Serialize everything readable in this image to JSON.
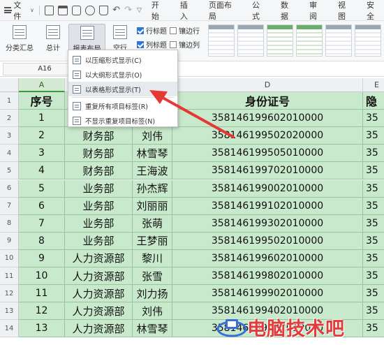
{
  "menubar": {
    "file_label": "文件",
    "tabs": [
      "开始",
      "插入",
      "页面布局",
      "公式",
      "数据",
      "审阅",
      "视图",
      "安全"
    ]
  },
  "ribbon": {
    "buttons": [
      "分类汇总",
      "总计",
      "报表布局",
      "空行"
    ],
    "checkboxes": [
      {
        "label": "行标题",
        "checked": true
      },
      {
        "label": "镶边行",
        "checked": false
      },
      {
        "label": "列标题",
        "checked": true
      },
      {
        "label": "镶边列",
        "checked": false
      }
    ]
  },
  "formula_bar": {
    "cell_ref": "A16"
  },
  "dropdown": {
    "items": [
      "以压缩形式显示(C)",
      "以大纲形式显示(O)",
      "以表格形式显示(T)",
      "重复所有项目标签(R)",
      "不显示重复项目标签(N)"
    ],
    "hovered_index": 2
  },
  "columns": [
    "A",
    "B",
    "C",
    "D",
    "E"
  ],
  "rows": [
    "1",
    "2",
    "3",
    "4",
    "5",
    "6",
    "7",
    "8",
    "9",
    "10",
    "11",
    "12",
    "13",
    "14"
  ],
  "table": {
    "header": [
      "序号",
      "部门",
      "姓名",
      "身份证号",
      "隐"
    ],
    "data": [
      [
        "1",
        "财务部",
        "张三",
        "358146199602010000",
        "35"
      ],
      [
        "2",
        "财务部",
        "刘伟",
        "358146199502020000",
        "35"
      ],
      [
        "3",
        "财务部",
        "林雪琴",
        "358146199505010000",
        "35"
      ],
      [
        "4",
        "财务部",
        "王海波",
        "358146199702010000",
        "35"
      ],
      [
        "5",
        "业务部",
        "孙杰辉",
        "358146199002010000",
        "35"
      ],
      [
        "6",
        "业务部",
        "刘丽丽",
        "358146199102010000",
        "35"
      ],
      [
        "7",
        "业务部",
        "张萌",
        "358146199302010000",
        "35"
      ],
      [
        "8",
        "业务部",
        "王梦丽",
        "358146199502010000",
        "35"
      ],
      [
        "9",
        "人力资源部",
        "黎川",
        "358146199602010000",
        "35"
      ],
      [
        "10",
        "人力资源部",
        "张雪",
        "358146199802010000",
        "35"
      ],
      [
        "11",
        "人力资源部",
        "刘力扬",
        "358146199902010000",
        "35"
      ],
      [
        "12",
        "人力资源部",
        "刘伟",
        "358146199402010000",
        "35"
      ],
      [
        "13",
        "人力资源部",
        "林雪琴",
        "358146199602010000",
        "35"
      ]
    ]
  },
  "watermark": {
    "text": "电脑技术吧"
  },
  "colors": {
    "cell_fill": "#c9e9cc",
    "arrow": "#e53935",
    "watermark": "#e23b3b"
  }
}
